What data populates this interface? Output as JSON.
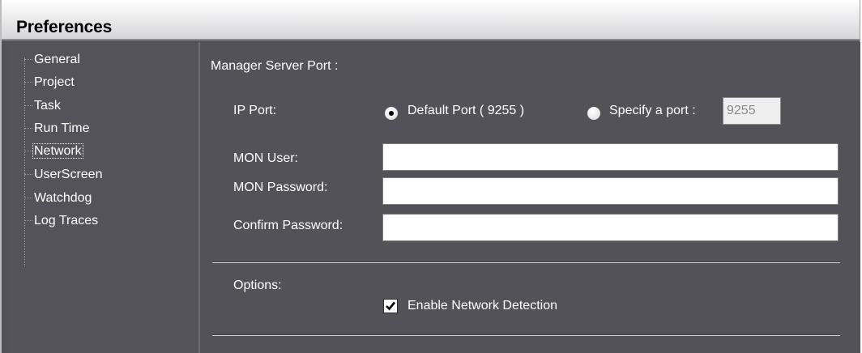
{
  "window": {
    "title": "Preferences"
  },
  "tree": {
    "items": [
      {
        "label": "General"
      },
      {
        "label": "Project"
      },
      {
        "label": "Task"
      },
      {
        "label": "Run Time"
      },
      {
        "label": "Network",
        "selected": true
      },
      {
        "label": "UserScreen"
      },
      {
        "label": "Watchdog"
      },
      {
        "label": "Log Traces"
      }
    ]
  },
  "network": {
    "section_title": "Manager Server Port :",
    "ip_port_label": "IP Port:",
    "default_port_label": "Default Port ( 9255 )",
    "default_port_selected": true,
    "specify_port_label": "Specify a port :",
    "specify_port_value": "9255",
    "mon_user_label": "MON User:",
    "mon_user_value": "",
    "mon_password_label": "MON Password:",
    "mon_password_value": "",
    "confirm_password_label": "Confirm Password:",
    "confirm_password_value": "",
    "options_label": "Options:",
    "enable_detection_label": "Enable Network Detection",
    "enable_detection_checked": true
  },
  "colors": {
    "panel_background": "#535258",
    "text": "#ffffff",
    "title_bar": "#e6e6e8"
  }
}
